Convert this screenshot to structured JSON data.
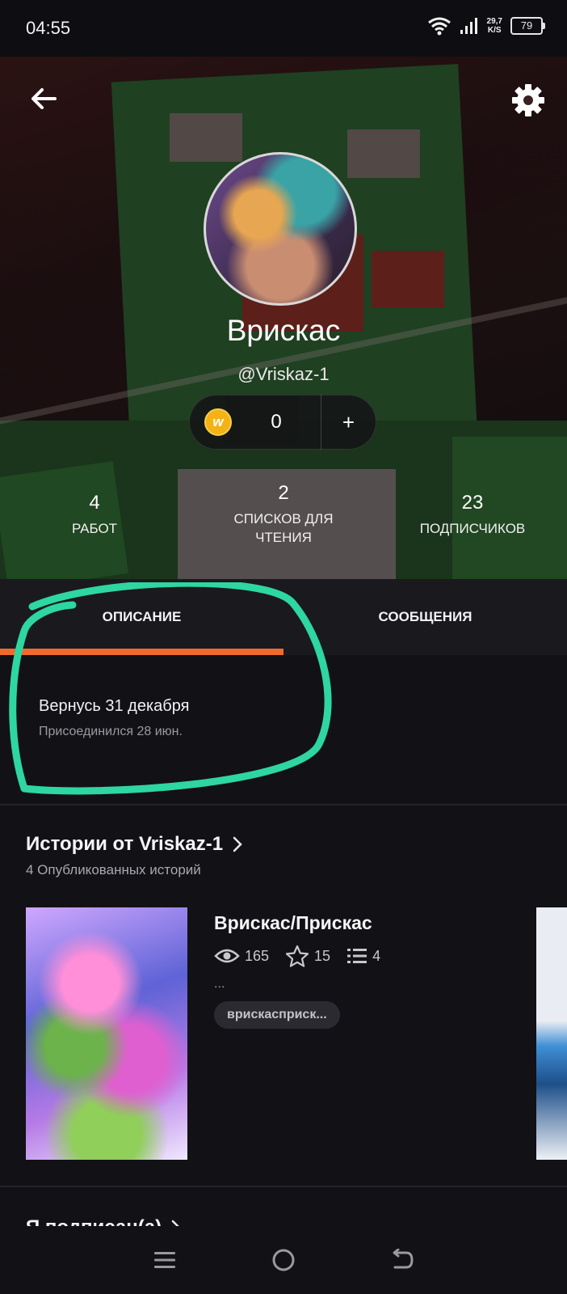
{
  "status_bar": {
    "time": "04:55",
    "net_speed_value": "29,7",
    "net_speed_unit": "K/S",
    "battery": "79"
  },
  "profile": {
    "display_name": "Врискас",
    "username": "@Vriskaz-1",
    "coins": "0",
    "coin_add_label": "+",
    "coin_icon_letter": "w"
  },
  "stats": [
    {
      "value": "4",
      "label": "РАБОТ"
    },
    {
      "value": "2",
      "label": "СПИСКОВ ДЛЯ ЧТЕНИЯ"
    },
    {
      "value": "23",
      "label": "ПОДПИСЧИКОВ"
    }
  ],
  "tabs": [
    {
      "label": "ОПИСАНИЕ",
      "active": true
    },
    {
      "label": "СООБЩЕНИЯ",
      "active": false
    }
  ],
  "about": {
    "text": "Вернусь 31 декабря",
    "joined": "Присоединился 28 июн."
  },
  "stories_section": {
    "title": "Истории от Vriskaz-1",
    "subtitle": "4 Опубликованных историй",
    "stories": [
      {
        "title": "Врискас/Прискас",
        "reads": "165",
        "votes": "15",
        "parts": "4",
        "description": "...",
        "tag": "врискасприск..."
      }
    ]
  },
  "following_section": {
    "title": "Я подписан(а)"
  },
  "colors": {
    "accent": "#f06a2b",
    "annotation": "#2ed6a0",
    "coin": "#f3b316"
  }
}
